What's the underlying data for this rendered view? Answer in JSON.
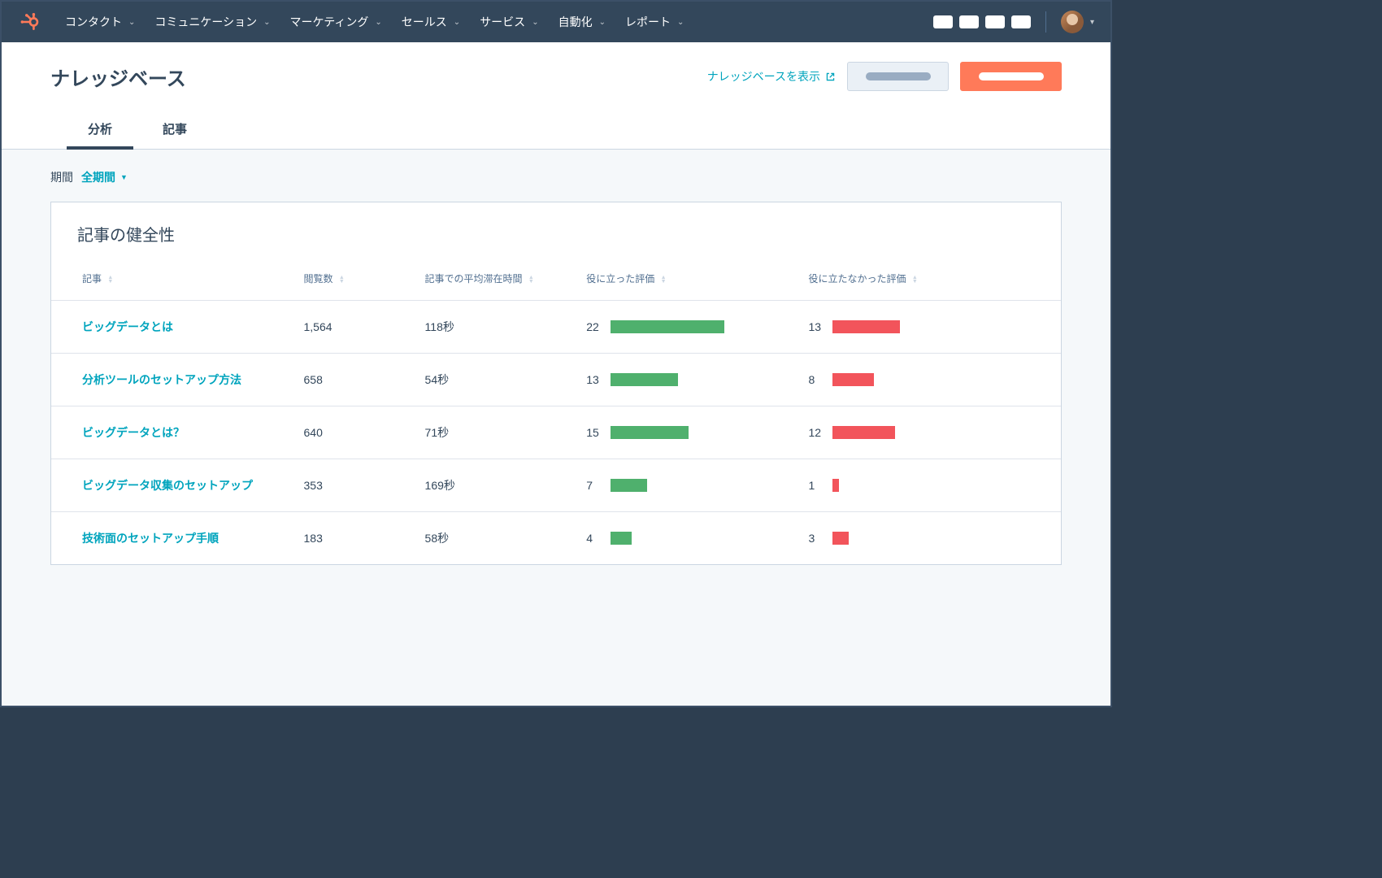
{
  "nav": {
    "items": [
      {
        "label": "コンタクト"
      },
      {
        "label": "コミュニケーション"
      },
      {
        "label": "マーケティング"
      },
      {
        "label": "セールス"
      },
      {
        "label": "サービス"
      },
      {
        "label": "自動化"
      },
      {
        "label": "レポート"
      }
    ]
  },
  "page": {
    "title": "ナレッジベース",
    "view_link": "ナレッジベースを表示"
  },
  "tabs": {
    "analytics": "分析",
    "articles": "記事"
  },
  "filter": {
    "label": "期間",
    "value": "全期間"
  },
  "card": {
    "title": "記事の健全性",
    "columns": {
      "article": "記事",
      "views": "閲覧数",
      "avg_time": "記事での平均滞在時間",
      "helpful": "役に立った評価",
      "unhelpful": "役に立たなかった評価"
    },
    "rows": [
      {
        "article": "ビッグデータとは",
        "views": "1,564",
        "avg_time": "118秒",
        "helpful": 22,
        "unhelpful": 13
      },
      {
        "article": "分析ツールのセットアップ方法",
        "views": "658",
        "avg_time": "54秒",
        "helpful": 13,
        "unhelpful": 8
      },
      {
        "article": "ビッグデータとは？",
        "views": "640",
        "avg_time": "71秒",
        "helpful": 15,
        "unhelpful": 12
      },
      {
        "article": "ビッグデータ収集のセットアップ",
        "views": "353",
        "avg_time": "169秒",
        "helpful": 7,
        "unhelpful": 1
      },
      {
        "article": "技術面のセットアップ手順",
        "views": "183",
        "avg_time": "58秒",
        "helpful": 4,
        "unhelpful": 3
      }
    ],
    "bar_max": 22,
    "colors": {
      "green": "#4fb06d",
      "red": "#f2545b",
      "accent": "#00a4bd",
      "primary_btn": "#ff7a59"
    }
  }
}
